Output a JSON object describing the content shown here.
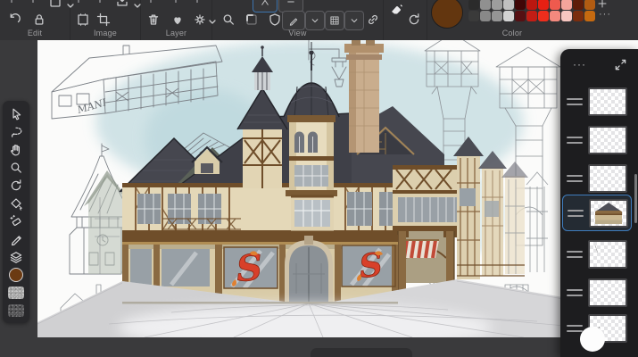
{
  "toolbar": {
    "groups": [
      {
        "label": "Edit",
        "icons": [
          "undo-icon",
          "lock-icon",
          "clipboard-icon"
        ]
      },
      {
        "label": "Image",
        "icons": [
          "document-frame-icon",
          "crop-icon",
          "export-icon"
        ]
      },
      {
        "label": "Layer",
        "icons": [
          "trash-icon",
          "mask-icon",
          "gear-icon"
        ]
      },
      {
        "label": "View",
        "icons": [
          "zoom-icon",
          "snap-icon",
          "assistant-shield-icon",
          "pen-toggle-icon",
          "grid-toggle-icon",
          "link-icon"
        ]
      },
      {
        "label": "Color",
        "icons": [
          "current-color-circle",
          "swatch-grid",
          "more-options"
        ]
      }
    ],
    "misc_icons": [
      "eraser-icon",
      "history-icon"
    ]
  },
  "color_panel": {
    "current_color": "#63360f",
    "more_label": "···",
    "swatches": {
      "row1": [
        "#2b2b2b",
        "#909090",
        "#9d9d9d",
        "#c0c0c0",
        "#400607",
        "#bb1710",
        "#e72013",
        "#ef5a4e",
        "#f4a49b",
        "#5e1c09",
        "#b25c12"
      ],
      "row2": [
        "#3a3a3a",
        "#888888",
        "#959595",
        "#d3d3d3",
        "#561013",
        "#c21d15",
        "#ee2e1c",
        "#f4897e",
        "#f7c6c0",
        "#7a2d0e",
        "#c66a10"
      ]
    }
  },
  "tool_palette": {
    "current_color": "#6b3a12",
    "tools": [
      "move-tool",
      "lasso-tool",
      "hand-tool",
      "zoom-tool",
      "rotate-tool",
      "shape-tool",
      "magic-eraser-tool",
      "pencil-tool",
      "layers-tool",
      "color-swatch",
      "texture-swatch-light",
      "texture-swatch-dark"
    ]
  },
  "layers_panel": {
    "more_label": "···",
    "selection_color": "#3f7dbe",
    "rows": [
      {
        "thumbnail": "empty",
        "selected": false
      },
      {
        "thumbnail": "empty",
        "selected": false
      },
      {
        "thumbnail": "empty",
        "selected": false
      },
      {
        "thumbnail": "artwork",
        "selected": true
      },
      {
        "thumbnail": "faint",
        "selected": false
      },
      {
        "thumbnail": "empty",
        "selected": false
      },
      {
        "thumbnail": "sketch",
        "selected": false
      }
    ]
  },
  "canvas": {
    "handwriting_note": "MANI",
    "shop_sign_letter": "S"
  }
}
